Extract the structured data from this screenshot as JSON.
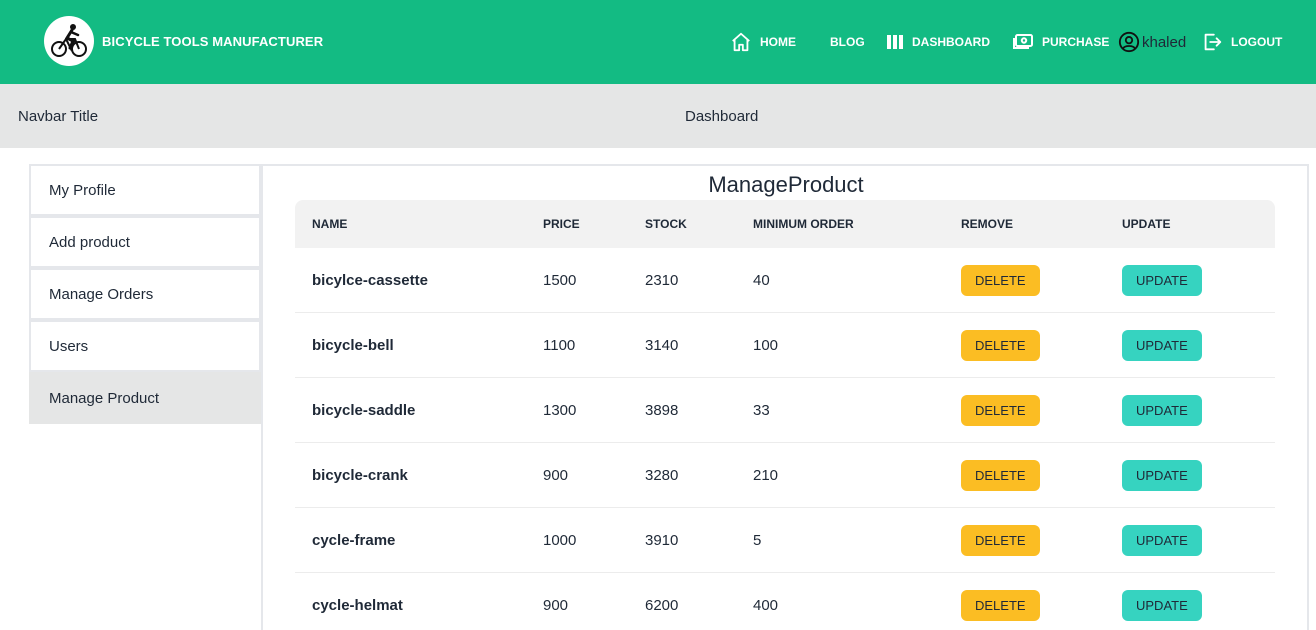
{
  "header": {
    "brand": "BICYCLE TOOLS MANUFACTURER",
    "nav": {
      "home": "HOME",
      "blog": "BLOG",
      "dashboard": "DASHBOARD",
      "purchase": "PURCHASE",
      "user": "khaled",
      "logout": "LOGOUT"
    },
    "icons": [
      "bicycle-logo-icon",
      "home-icon",
      "dashboard-columns-icon",
      "cash-icon",
      "user-circle-icon",
      "logout-icon"
    ],
    "color": "#13bb83"
  },
  "subbar": {
    "title": "Navbar Title",
    "center": "Dashboard"
  },
  "sidebar": {
    "items": [
      {
        "label": "My Profile"
      },
      {
        "label": "Add product"
      },
      {
        "label": "Manage Orders"
      },
      {
        "label": "Users"
      },
      {
        "label": "Manage Product",
        "active": true
      }
    ]
  },
  "main": {
    "title": "ManageProduct",
    "columns": {
      "name": "NAME",
      "price": "PRICE",
      "stock": "STOCK",
      "min_order": "MINIMUM ORDER",
      "remove": "REMOVE",
      "update": "UPDATE"
    },
    "rows": [
      {
        "name": "bicylce-cassette",
        "price": "1500",
        "stock": "2310",
        "min_order": "40",
        "delete_label": "DELETE",
        "update_label": "UPDATE"
      },
      {
        "name": "bicycle-bell",
        "price": "1100",
        "stock": "3140",
        "min_order": "100",
        "delete_label": "DELETE",
        "update_label": "UPDATE"
      },
      {
        "name": "bicycle-saddle",
        "price": "1300",
        "stock": "3898",
        "min_order": "33",
        "delete_label": "DELETE",
        "update_label": "UPDATE"
      },
      {
        "name": "bicycle-crank",
        "price": "900",
        "stock": "3280",
        "min_order": "210",
        "delete_label": "DELETE",
        "update_label": "UPDATE"
      },
      {
        "name": "cycle-frame",
        "price": "1000",
        "stock": "3910",
        "min_order": "5",
        "delete_label": "DELETE",
        "update_label": "UPDATE"
      },
      {
        "name": "cycle-helmat",
        "price": "900",
        "stock": "6200",
        "min_order": "400",
        "delete_label": "DELETE",
        "update_label": "UPDATE"
      }
    ],
    "colors": {
      "delete": "#fbbd23",
      "update": "#36d3c0"
    }
  }
}
